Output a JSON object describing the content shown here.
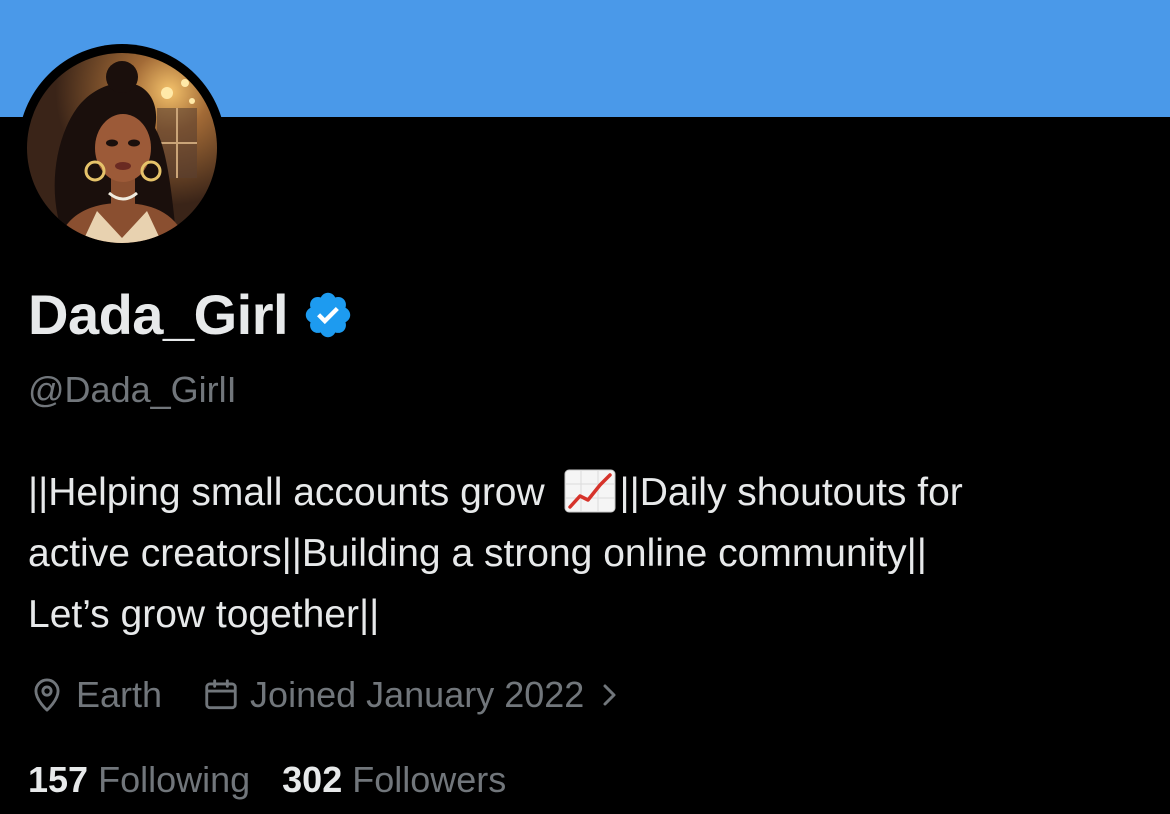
{
  "profile": {
    "display_name": "Dada_Girl",
    "handle": "@Dada_GirlI",
    "verified_icon": "verified-badge-icon",
    "bio_lines": [
      [
        "||Helping small accounts grow ",
        "||Daily shoutouts for"
      ],
      "active creators||Building a strong online community||",
      "Let’s grow together||"
    ],
    "bio_emoji": "chart-increasing-emoji",
    "location": "Earth",
    "location_icon": "location-pin-icon",
    "joined": "Joined January 2022",
    "joined_icon": "calendar-icon",
    "joined_chevron_icon": "chevron-right-icon",
    "following_count": "157",
    "following_label": "Following",
    "followers_count": "302",
    "followers_label": "Followers"
  },
  "colors": {
    "banner": "#4a99e9",
    "background": "#000000",
    "primary_text": "#e7e9ea",
    "secondary_text": "#71767b",
    "verified_badge": "#1d9bf0"
  }
}
